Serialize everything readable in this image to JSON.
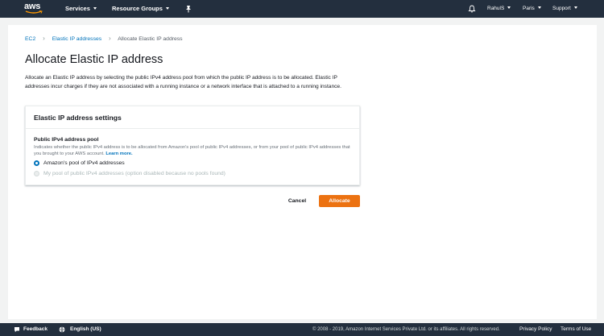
{
  "topnav": {
    "logo_text": "aws",
    "services": "Services",
    "resource_groups": "Resource Groups",
    "user": "RahulS",
    "region": "Paris",
    "support": "Support"
  },
  "breadcrumb": {
    "root": "EC2",
    "parent": "Elastic IP addresses",
    "current": "Allocate Elastic IP address"
  },
  "page": {
    "title": "Allocate Elastic IP address",
    "description": "Allocate an Elastic IP address by selecting the public IPv4 address pool from which the public IP address is to be allocated. Elastic IP addresses incur charges if they are not associated with a running instance or a network interface that is attached to a running instance."
  },
  "panel": {
    "title": "Elastic IP address settings",
    "field_label": "Public IPv4 address pool",
    "field_desc": "Indicates whether the public IPv4 address is to be allocated from Amazon's pool of public IPv4 addresses, or from your pool of public IPv4 addresses that you brought to your AWS account.",
    "learn_more": "Learn more.",
    "options": [
      {
        "label": "Amazon's pool of IPv4 addresses",
        "checked": true
      },
      {
        "label": "My pool of public IPv4 addresses (option disabled because no pools found)",
        "disabled": true
      }
    ]
  },
  "actions": {
    "cancel": "Cancel",
    "allocate": "Allocate"
  },
  "footer": {
    "feedback": "Feedback",
    "language": "English (US)",
    "copyright": "© 2008 - 2019, Amazon Internet Services Private Ltd. or its affiliates. All rights reserved.",
    "privacy": "Privacy Policy",
    "terms": "Terms of Use"
  },
  "colors": {
    "nav_bg": "#232f3e",
    "link": "#0073bb",
    "primary_button": "#ec7211"
  }
}
